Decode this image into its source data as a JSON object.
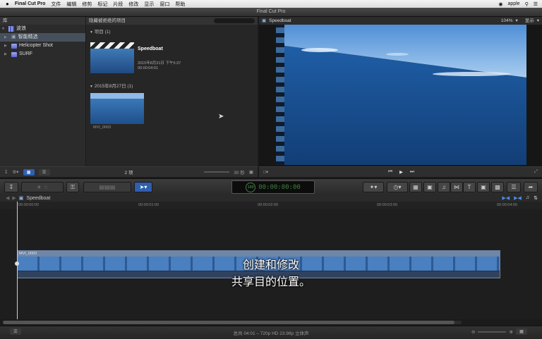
{
  "menubar": {
    "app_name": "Final Cut Pro",
    "menus": [
      "文件",
      "编辑",
      "修剪",
      "标记",
      "片段",
      "修改",
      "显示",
      "窗口",
      "帮助"
    ],
    "user": "apple"
  },
  "window": {
    "title": "Final Cut Pro"
  },
  "library": {
    "header": "库",
    "root": "波浪",
    "items": [
      {
        "label": "智能精选",
        "selected": true
      },
      {
        "label": "Helicopter Shot",
        "selected": false
      },
      {
        "label": "SURF",
        "selected": false
      }
    ]
  },
  "browser": {
    "filter": "隐藏被拒绝的项目",
    "section1": {
      "label": "项目",
      "count": "(1)"
    },
    "project": {
      "name": "Speedboat",
      "date": "2015年8月31日 下午5:37",
      "duration": "00:00:04:01"
    },
    "section2": {
      "label": "2015年8月27日",
      "count": "(1)"
    },
    "clip": {
      "name": "MVI_0003"
    },
    "item_count": "2 项",
    "zoom": "30 秒"
  },
  "viewer": {
    "title": "Speedboat",
    "zoom": "104%",
    "view_menu": "显示"
  },
  "toolbar": {
    "timecode": "00:00:00:00",
    "percent": "100"
  },
  "timeline": {
    "project": "Speedboat",
    "ruler": [
      "00:00:00:00",
      "00:00:01:00",
      "00:00:02:00",
      "00:00:03:00",
      "00:00:04:00"
    ],
    "clip_name": "MVI_0003",
    "subtitle_line1": "创建和修改",
    "subtitle_line2": "共享目的位置。"
  },
  "statusbar": {
    "info": "总共 04:01 – 720p HD 23.98p 立体声"
  }
}
